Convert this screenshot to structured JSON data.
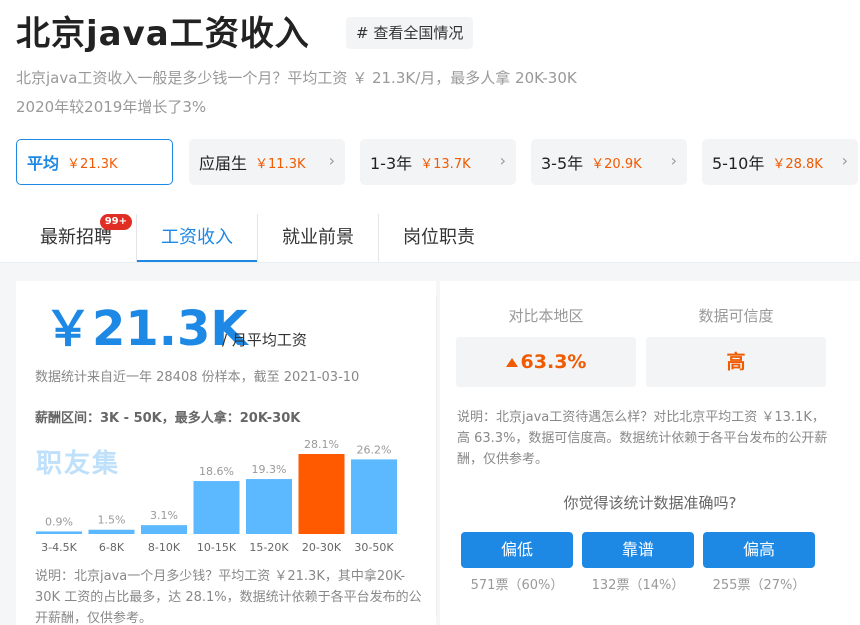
{
  "header": {
    "title": "北京java工资收入",
    "tag_button": "# 查看全国情况",
    "desc_line1": "北京java工资收入一般是多少钱一个月？平均工资 ￥ 21.3K/月，最多人拿 20K-30K",
    "desc_line2": "2020年较2019年增长了3%"
  },
  "experience_ranges": [
    {
      "name": "平均",
      "value": "￥21.3K",
      "active": true
    },
    {
      "name": "应届生",
      "value": "￥11.3K"
    },
    {
      "name": "1-3年",
      "value": "￥13.7K"
    },
    {
      "name": "3-5年",
      "value": "￥20.9K"
    },
    {
      "name": "5-10年",
      "value": "￥28.8K"
    }
  ],
  "tabs": [
    {
      "label": "最新招聘",
      "badge": "99+"
    },
    {
      "label": "工资收入",
      "active": true
    },
    {
      "label": "就业前景"
    },
    {
      "label": "岗位职责"
    }
  ],
  "summary": {
    "avg_salary": "￥21.3K",
    "avg_unit": "/ 月平均工资",
    "source": "数据统计来自近一年 28408 份样本，截至 2021-03-10",
    "salary_range": "薪酬区间：3K - 50K，最多人拿：20K-30K",
    "watermark": "职友集",
    "note": "说明：北京java一个月多少钱？平均工资 ￥21.3K，其中拿20K-30K 工资的占比最多，达 28.1%，数据统计依赖于各平台发布的公开薪酬，仅供参考。"
  },
  "chart_data": {
    "type": "bar",
    "categories": [
      "3-4.5K",
      "6-8K",
      "8-10K",
      "10-15K",
      "15-20K",
      "20-30K",
      "30-50K"
    ],
    "values": [
      0.9,
      1.5,
      3.1,
      18.6,
      19.3,
      28.1,
      26.2
    ],
    "value_labels": [
      "0.9%",
      "1.5%",
      "3.1%",
      "18.6%",
      "19.3%",
      "28.1%",
      "26.2%"
    ],
    "highlight_index": 5,
    "ylim": [
      0,
      28.1
    ],
    "colors": {
      "bar": "#5cb8ff",
      "highlight": "#ff5a00"
    }
  },
  "comparison": {
    "local_label": "对比本地区",
    "local_value": "63.3%",
    "credibility_label": "数据可信度",
    "credibility_value": "高",
    "note": "说明：北京java工资待遇怎么样？对比北京平均工资 ￥13.1K，高 63.3%，数据可信度高。数据统计依赖于各平台发布的公开薪酬，仅供参考。"
  },
  "vote": {
    "question": "你觉得该统计数据准确吗?",
    "options": [
      {
        "label": "偏低",
        "count": "571票（60%）"
      },
      {
        "label": "靠谱",
        "count": "132票（14%）"
      },
      {
        "label": "偏高",
        "count": "255票（27%）"
      }
    ]
  },
  "colors": {
    "accent": "#1e88e5",
    "orange": "#f05a00"
  }
}
